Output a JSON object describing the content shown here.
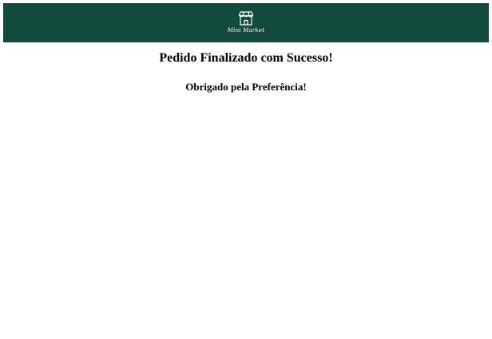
{
  "header": {
    "logo_icon": "storefront-icon",
    "logo_text": "Mini Market",
    "background_color": "#134a3e"
  },
  "main": {
    "title": "Pedido Finalizado com Sucesso!",
    "subtitle": "Obrigado pela Preferência!"
  }
}
